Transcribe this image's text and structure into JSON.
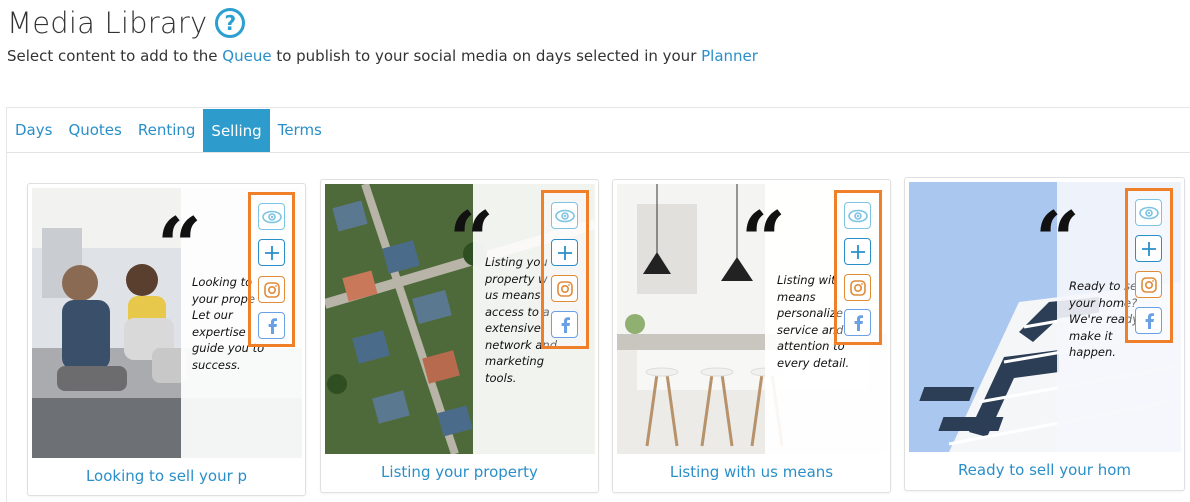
{
  "header": {
    "title": "Media Library",
    "help_icon": "?",
    "subtitle_before": "Select content to add to the ",
    "queue_link": "Queue",
    "subtitle_middle": " to publish to your social media on days selected in your ",
    "planner_link": "Planner"
  },
  "tabs": [
    {
      "label": "Days",
      "active": false
    },
    {
      "label": "Quotes",
      "active": false
    },
    {
      "label": "Renting",
      "active": false
    },
    {
      "label": "Selling",
      "active": true
    },
    {
      "label": "Terms",
      "active": false
    }
  ],
  "colors": {
    "accent": "#2d9bcb",
    "link": "#2a8fc9",
    "highlight_box": "#f07f2a",
    "instagram": "#e08b3a",
    "facebook": "#6aa0e6"
  },
  "icons": {
    "preview": "eye-icon",
    "add": "plus-icon",
    "instagram": "instagram-icon",
    "facebook": "facebook-icon"
  },
  "quote_glyph": "“",
  "cards": [
    {
      "caption": "Looking to sell your p",
      "quote": "Looking to\nyour prope\nLet our\nexpertise\nguide you to\nsuccess."
    },
    {
      "caption": "Listing your property",
      "quote": "Listing you\nproperty w\nus means\naccess to a\nextensive\nnetwork and\nmarketing\ntools."
    },
    {
      "caption": "Listing with us means",
      "quote": "Listing wit\nmeans\npersonalize\nservice and\nattention to\nevery detail."
    },
    {
      "caption": "Ready to sell your hom",
      "quote": "Ready to se\nyour home?\nWe're ready\nmake it\nhappen."
    }
  ]
}
